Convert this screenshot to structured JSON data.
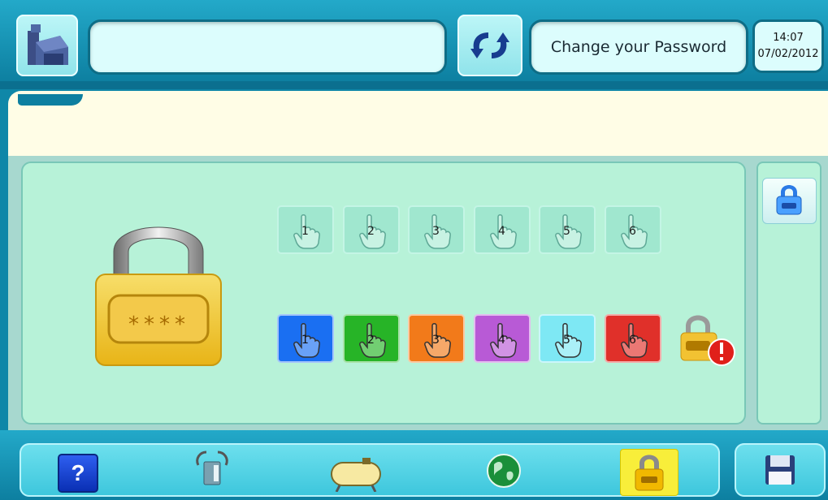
{
  "header": {
    "title": "Change your Password",
    "time": "14:07",
    "date": "07/02/2012",
    "message": ""
  },
  "lock": {
    "code_mask": "****"
  },
  "keys_pale": [
    "1",
    "2",
    "3",
    "4",
    "5",
    "6"
  ],
  "keys_colored": [
    {
      "label": "1",
      "color": "#1a6ff2"
    },
    {
      "label": "2",
      "color": "#27b427"
    },
    {
      "label": "3",
      "color": "#f27a1a"
    },
    {
      "label": "4",
      "color": "#b85ad6"
    },
    {
      "label": "5",
      "color": "#7ee8f4"
    },
    {
      "label": "6",
      "color": "#e0302a"
    }
  ],
  "icons": {
    "home": "home-icon",
    "refresh": "refresh-icon",
    "help": "help-icon",
    "wireless": "wireless-device-icon",
    "tank": "tank-icon",
    "globe": "globe-icon",
    "lock": "lock-icon",
    "save": "save-icon"
  },
  "help_label": "?"
}
